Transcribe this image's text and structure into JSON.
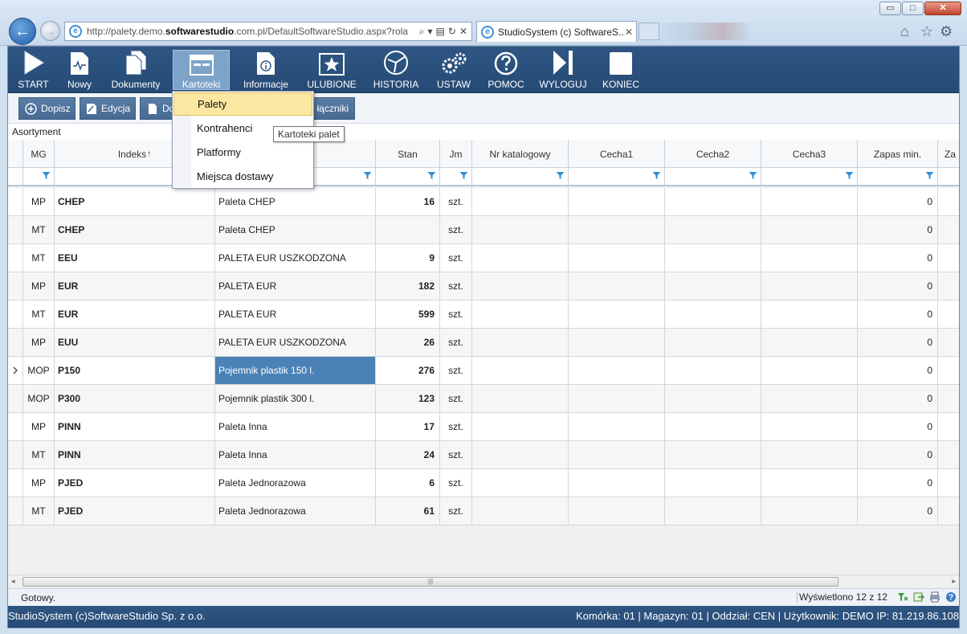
{
  "browser": {
    "url": "http://palety.demo.softwarestudio.com.pl/DefaultSoftwareStudio.aspx?rola",
    "tab_title": "StudioSystem (c) SoftwareS...",
    "tab_close": "✕",
    "window_buttons": {
      "minimize": "▭",
      "maximize": "□",
      "close": "✕"
    }
  },
  "toolbar": {
    "buttons": [
      {
        "label": "START",
        "icon": "play-icon"
      },
      {
        "label": "Nowy",
        "icon": "new-document-icon"
      },
      {
        "label": "Dokumenty",
        "icon": "documents-icon"
      },
      {
        "label": "Kartoteki",
        "icon": "cards-icon",
        "active": true
      },
      {
        "label": "Informacje",
        "icon": "info-icon"
      },
      {
        "label": "ULUBIONE",
        "icon": "star-icon"
      },
      {
        "label": "HISTORIA",
        "icon": "history-icon"
      },
      {
        "label": "USTAW",
        "icon": "gears-icon"
      },
      {
        "label": "POMOC",
        "icon": "help-icon"
      },
      {
        "label": "WYLOGUJ",
        "icon": "logout-icon"
      },
      {
        "label": "KONIEC",
        "icon": "exit-icon"
      }
    ]
  },
  "actions": {
    "dopisz": "Dopisz",
    "edycja": "Edycja",
    "do": "Do",
    "zalaczniki": "łączniki"
  },
  "section_label": "Asortyment",
  "dropdown": {
    "items": [
      "Palety",
      "Kontrahenci",
      "Platformy",
      "Miejsca dostawy"
    ],
    "tooltip": "Kartoteki palet"
  },
  "grid": {
    "columns": [
      "MG",
      "Indeks",
      "",
      "Stan",
      "Jm",
      "Nr katalogowy",
      "Cecha1",
      "Cecha2",
      "Cecha3",
      "Zapas min.",
      "Za"
    ],
    "sort_indicator": "↑",
    "selected_row": 6,
    "rows": [
      {
        "mg": "MP",
        "indeks": "CHEP",
        "nazwa": "Paleta CHEP",
        "stan": "16",
        "jm": "szt.",
        "zapas": "0"
      },
      {
        "mg": "MT",
        "indeks": "CHEP",
        "nazwa": "Paleta CHEP",
        "stan": "",
        "jm": "szt.",
        "zapas": "0"
      },
      {
        "mg": "MT",
        "indeks": "EEU",
        "nazwa": "PALETA EUR USZKODZONA",
        "stan": "9",
        "jm": "szt.",
        "zapas": "0"
      },
      {
        "mg": "MP",
        "indeks": "EUR",
        "nazwa": "PALETA EUR",
        "stan": "182",
        "jm": "szt.",
        "zapas": "0"
      },
      {
        "mg": "MT",
        "indeks": "EUR",
        "nazwa": "PALETA EUR",
        "stan": "599",
        "jm": "szt.",
        "zapas": "0"
      },
      {
        "mg": "MP",
        "indeks": "EUU",
        "nazwa": "PALETA EUR USZKODZONA",
        "stan": "26",
        "jm": "szt.",
        "zapas": "0"
      },
      {
        "mg": "MOP",
        "indeks": "P150",
        "nazwa": "Pojemnik plastik 150 l.",
        "stan": "276",
        "jm": "szt.",
        "zapas": "0"
      },
      {
        "mg": "MOP",
        "indeks": "P300",
        "nazwa": "Pojemnik plastik 300 l.",
        "stan": "123",
        "jm": "szt.",
        "zapas": "0"
      },
      {
        "mg": "MP",
        "indeks": "PINN",
        "nazwa": "Paleta Inna",
        "stan": "17",
        "jm": "szt.",
        "zapas": "0"
      },
      {
        "mg": "MT",
        "indeks": "PINN",
        "nazwa": "Paleta Inna",
        "stan": "24",
        "jm": "szt.",
        "zapas": "0"
      },
      {
        "mg": "MP",
        "indeks": "PJED",
        "nazwa": "Paleta Jednorazowa",
        "stan": "6",
        "jm": "szt.",
        "zapas": "0"
      },
      {
        "mg": "MT",
        "indeks": "PJED",
        "nazwa": "Paleta Jednorazowa",
        "stan": "61",
        "jm": "szt.",
        "zapas": "0"
      }
    ]
  },
  "status": {
    "text": "Gotowy.",
    "count": "Wyświetlono 12 z 12"
  },
  "footer": {
    "left": "StudioSystem (c)SoftwareStudio Sp. z o.o.",
    "right": "Komórka: 01 | Magazyn: 01 | Oddział: CEN | Użytkownik: DEMO IP: 81.219.86.108"
  },
  "colors": {
    "toolbar_bg": "#2b5080",
    "active_tab": "#7ea3c8",
    "selection": "#4a82b6",
    "highlight": "#fbe7a1"
  }
}
